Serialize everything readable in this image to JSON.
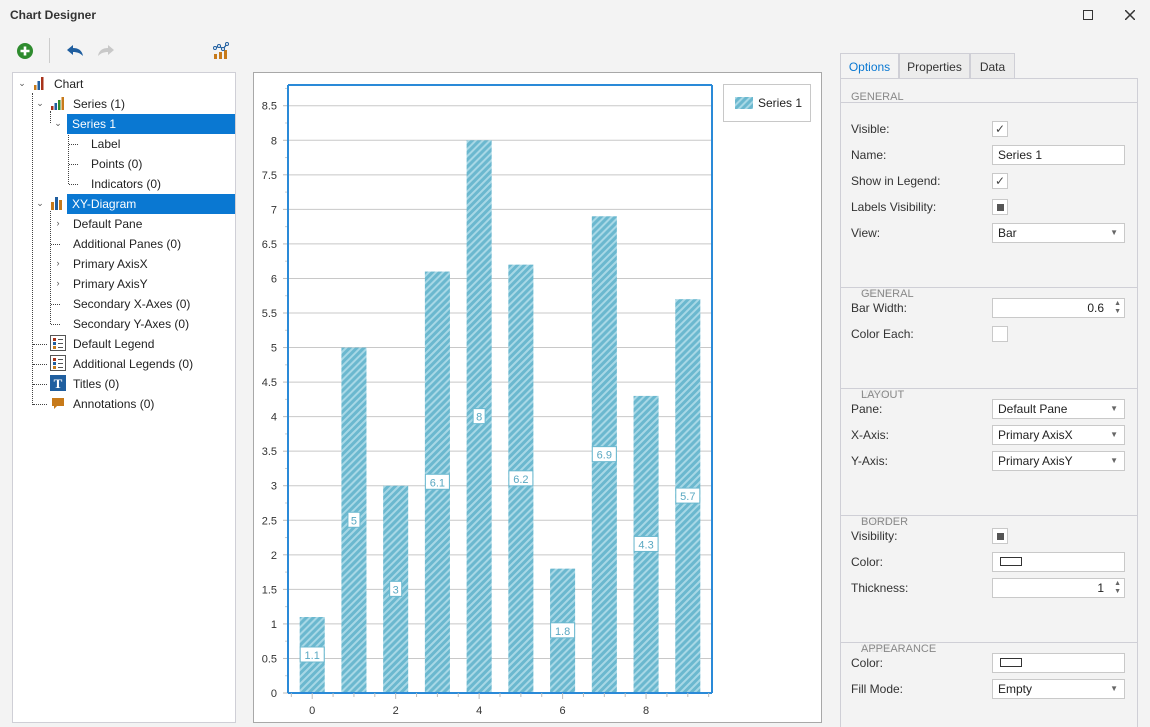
{
  "window": {
    "title": "Chart Designer",
    "maximize_icon": "maximize-icon",
    "close_icon": "close-icon"
  },
  "toolbar": {
    "add_icon": "add-icon",
    "undo_icon": "undo-icon",
    "redo_icon": "redo-icon",
    "chart_wizard_icon": "chart-wizard-icon"
  },
  "tree": {
    "chart": "Chart",
    "series_group": "Series (1)",
    "series1": "Series 1",
    "label": "Label",
    "points": "Points (0)",
    "indicators": "Indicators (0)",
    "xy_diagram": "XY-Diagram",
    "default_pane": "Default Pane",
    "additional_panes": "Additional Panes (0)",
    "primary_axis_x": "Primary AxisX",
    "primary_axis_y": "Primary AxisY",
    "secondary_x_axes": "Secondary X-Axes (0)",
    "secondary_y_axes": "Secondary Y-Axes (0)",
    "default_legend": "Default Legend",
    "additional_legends": "Additional Legends (0)",
    "titles": "Titles (0)",
    "annotations": "Annotations (0)"
  },
  "chart_data": {
    "type": "bar",
    "x": [
      0,
      1,
      2,
      3,
      4,
      5,
      6,
      7,
      8,
      9
    ],
    "values": [
      1.1,
      5,
      3,
      6.1,
      8,
      6.2,
      1.8,
      6.9,
      4.3,
      5.7
    ],
    "series": [
      {
        "name": "Series 1",
        "values": [
          1.1,
          5,
          3,
          6.1,
          8,
          6.2,
          1.8,
          6.9,
          4.3,
          5.7
        ]
      }
    ],
    "data_labels": [
      "1.1",
      "5",
      "3",
      "6.1",
      "8",
      "6.2",
      "1.8",
      "6.9",
      "4.3",
      "5.7"
    ],
    "title": "",
    "xlabel": "",
    "ylabel": "",
    "x_ticks": [
      "0",
      "2",
      "4",
      "6",
      "8"
    ],
    "y_ticks": [
      "0",
      "0.5",
      "1",
      "1.5",
      "2",
      "2.5",
      "3",
      "3.5",
      "4",
      "4.5",
      "5",
      "5.5",
      "6",
      "6.5",
      "7",
      "7.5",
      "8",
      "8.5"
    ],
    "xlim": [
      -0.58,
      9.58
    ],
    "ylim": [
      0,
      8.8
    ],
    "bar_width": 0.6,
    "grid": true,
    "legend": "top-right",
    "colors": {
      "bar": "#6bb8cf",
      "bar_stripe": "#a8d8e6",
      "axis": "#2a8ad8",
      "grid": "#c8c8c8"
    }
  },
  "legend": {
    "label": "Series 1"
  },
  "panel": {
    "tabs": [
      "Options",
      "Properties",
      "Data"
    ],
    "active_tab": "Options",
    "sections": {
      "general": "GENERAL",
      "view_general": [
        "VIEW: ",
        "GENERAL"
      ],
      "view_layout": [
        "VIEW: ",
        "LAYOUT"
      ],
      "view_border": [
        "VIEW: ",
        "BORDER"
      ],
      "view_appearance": [
        "VIEW: ",
        "APPEARANCE"
      ]
    },
    "props": {
      "visible": {
        "label": "Visible:",
        "checked": true
      },
      "name": {
        "label": "Name:",
        "value": "Series 1"
      },
      "show_in_legend": {
        "label": "Show in Legend:",
        "checked": true
      },
      "labels_visibility": {
        "label": "Labels Visibility:",
        "state": "indeterminate"
      },
      "view": {
        "label": "View:",
        "value": "Bar"
      },
      "bar_width": {
        "label": "Bar Width:",
        "value": "0.6"
      },
      "color_each": {
        "label": "Color Each:",
        "checked": false
      },
      "pane": {
        "label": "Pane:",
        "value": "Default Pane"
      },
      "x_axis": {
        "label": "X-Axis:",
        "value": "Primary AxisX"
      },
      "y_axis": {
        "label": "Y-Axis:",
        "value": "Primary AxisY"
      },
      "border_visibility": {
        "label": "Visibility:",
        "state": "indeterminate"
      },
      "border_color": {
        "label": "Color:"
      },
      "thickness": {
        "label": "Thickness:",
        "value": "1"
      },
      "appearance_color": {
        "label": "Color:"
      },
      "fill_mode": {
        "label": "Fill Mode:",
        "value": "Empty"
      }
    },
    "glyphs": {
      "check": "✓",
      "dropdown": "▼",
      "spin_up": "▲",
      "spin_down": "▼"
    }
  }
}
